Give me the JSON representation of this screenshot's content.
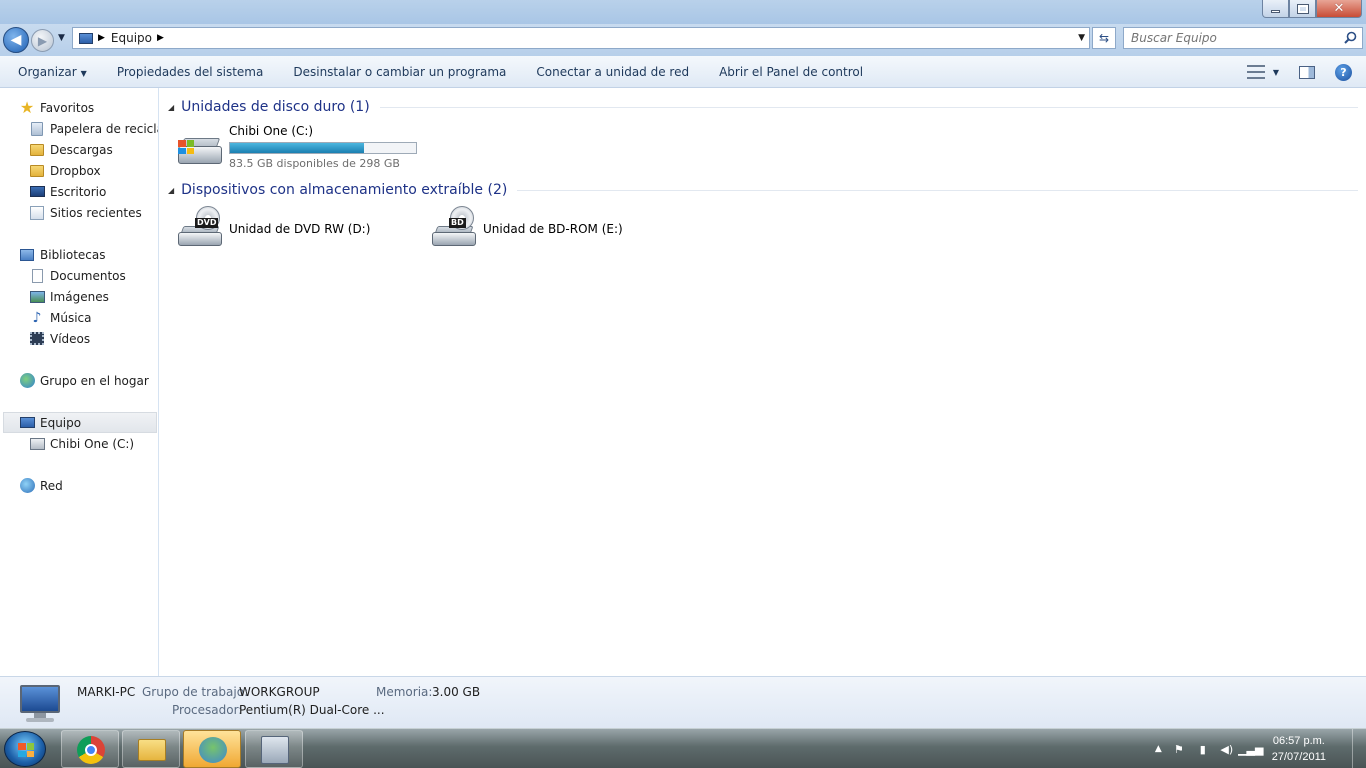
{
  "window": {
    "title_buttons": [
      "minimize",
      "maximize",
      "close"
    ]
  },
  "nav": {
    "address_icon": "computer-icon",
    "address_path": "Equipo",
    "search_placeholder": "Buscar Equipo"
  },
  "commands": {
    "organize": "Organizar",
    "items": [
      "Propiedades del sistema",
      "Desinstalar o cambiar un programa",
      "Conectar a unidad de red",
      "Abrir el Panel de control"
    ]
  },
  "sidebar": {
    "favorites": "Favoritos",
    "fav_items": [
      "Papelera de reciclaje",
      "Descargas",
      "Dropbox",
      "Escritorio",
      "Sitios recientes"
    ],
    "libraries": "Bibliotecas",
    "lib_items": [
      "Documentos",
      "Imágenes",
      "Música",
      "Vídeos"
    ],
    "homegroup": "Grupo en el hogar",
    "computer": "Equipo",
    "computer_items": [
      "Chibi One (C:)"
    ],
    "network": "Red"
  },
  "content": {
    "hdd_group": "Unidades de disco duro (1)",
    "removable_group": "Dispositivos con almacenamiento extraíble (2)",
    "hdd": {
      "name": "Chibi One (C:)",
      "free_text": "83.5 GB disponibles de 298 GB",
      "used_fraction": 0.72
    },
    "removable": [
      {
        "name": "Unidad de DVD RW (D:)",
        "badge": "DVD"
      },
      {
        "name": "Unidad de BD-ROM (E:)",
        "badge": "BD"
      }
    ]
  },
  "details": {
    "pc_name": "MARKI-PC",
    "workgroup_label": "Grupo de trabajo:",
    "workgroup_value": "WORKGROUP",
    "memory_label": "Memoria:",
    "memory_value": "3.00 GB",
    "cpu_label": "Procesador:",
    "cpu_value": "Pentium(R) Dual-Core ..."
  },
  "taskbar": {
    "time": "06:57 p.m.",
    "date": "27/07/2011",
    "pinned": [
      "chrome-icon",
      "explorer-icon",
      "people-icon",
      "calculator-icon"
    ]
  }
}
